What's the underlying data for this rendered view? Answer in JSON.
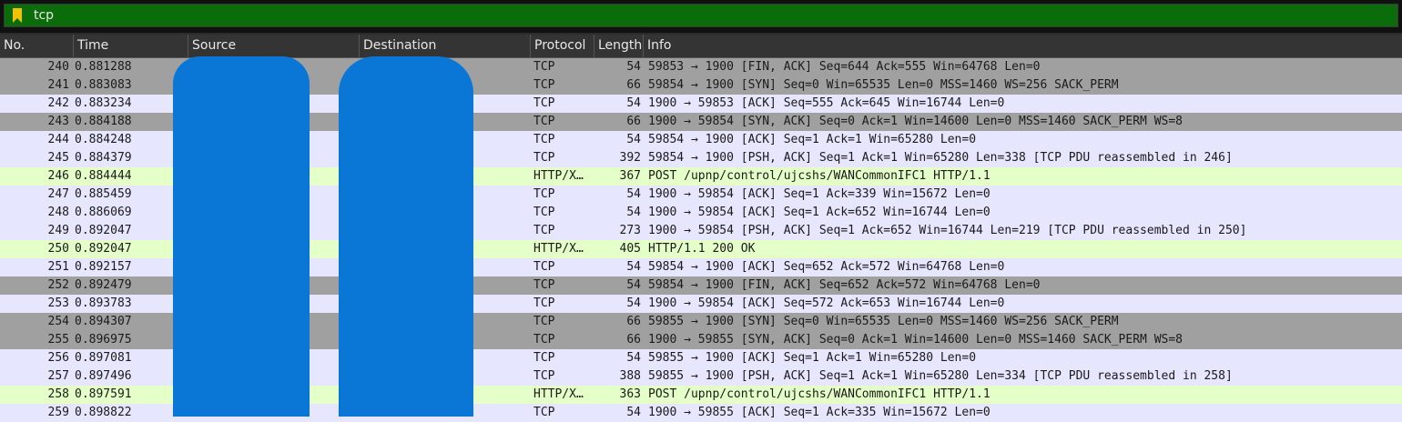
{
  "filter": {
    "value": "tcp",
    "icon": "bookmark-icon"
  },
  "columns": {
    "no": "No.",
    "time": "Time",
    "source": "Source",
    "destination": "Destination",
    "protocol": "Protocol",
    "length": "Length",
    "info": "Info"
  },
  "colors": {
    "filter_valid": "#0a6d0a",
    "tcp_row": "#e7e6ff",
    "tcp_flag_row": "#a0a0a0",
    "http_row": "#e4ffc7",
    "redaction": "#0a77d6"
  },
  "packets": [
    {
      "no": "240",
      "time": "0.881288",
      "protocol": "TCP",
      "length": "54",
      "info": "59853 → 1900 [FIN, ACK] Seq=644 Ack=555 Win=64768 Len=0",
      "kind": "tcp-flags"
    },
    {
      "no": "241",
      "time": "0.883083",
      "protocol": "TCP",
      "length": "66",
      "info": "59854 → 1900 [SYN] Seq=0 Win=65535 Len=0 MSS=1460 WS=256 SACK_PERM",
      "kind": "tcp-flags"
    },
    {
      "no": "242",
      "time": "0.883234",
      "protocol": "TCP",
      "length": "54",
      "info": "1900 → 59853 [ACK] Seq=555 Ack=645 Win=16744 Len=0",
      "kind": "tcp"
    },
    {
      "no": "243",
      "time": "0.884188",
      "protocol": "TCP",
      "length": "66",
      "info": "1900 → 59854 [SYN, ACK] Seq=0 Ack=1 Win=14600 Len=0 MSS=1460 SACK_PERM WS=8",
      "kind": "tcp-flags"
    },
    {
      "no": "244",
      "time": "0.884248",
      "protocol": "TCP",
      "length": "54",
      "info": "59854 → 1900 [ACK] Seq=1 Ack=1 Win=65280 Len=0",
      "kind": "tcp"
    },
    {
      "no": "245",
      "time": "0.884379",
      "protocol": "TCP",
      "length": "392",
      "info": "59854 → 1900 [PSH, ACK] Seq=1 Ack=1 Win=65280 Len=338 [TCP PDU reassembled in 246]",
      "kind": "tcp"
    },
    {
      "no": "246",
      "time": "0.884444",
      "protocol": "HTTP/X…",
      "length": "367",
      "info": "POST /upnp/control/ujcshs/WANCommonIFC1 HTTP/1.1",
      "kind": "http"
    },
    {
      "no": "247",
      "time": "0.885459",
      "protocol": "TCP",
      "length": "54",
      "info": "1900 → 59854 [ACK] Seq=1 Ack=339 Win=15672 Len=0",
      "kind": "tcp"
    },
    {
      "no": "248",
      "time": "0.886069",
      "protocol": "TCP",
      "length": "54",
      "info": "1900 → 59854 [ACK] Seq=1 Ack=652 Win=16744 Len=0",
      "kind": "tcp"
    },
    {
      "no": "249",
      "time": "0.892047",
      "protocol": "TCP",
      "length": "273",
      "info": "1900 → 59854 [PSH, ACK] Seq=1 Ack=652 Win=16744 Len=219 [TCP PDU reassembled in 250]",
      "kind": "tcp"
    },
    {
      "no": "250",
      "time": "0.892047",
      "protocol": "HTTP/X…",
      "length": "405",
      "info": "HTTP/1.1 200 OK",
      "kind": "http"
    },
    {
      "no": "251",
      "time": "0.892157",
      "protocol": "TCP",
      "length": "54",
      "info": "59854 → 1900 [ACK] Seq=652 Ack=572 Win=64768 Len=0",
      "kind": "tcp"
    },
    {
      "no": "252",
      "time": "0.892479",
      "protocol": "TCP",
      "length": "54",
      "info": "59854 → 1900 [FIN, ACK] Seq=652 Ack=572 Win=64768 Len=0",
      "kind": "tcp-flags"
    },
    {
      "no": "253",
      "time": "0.893783",
      "protocol": "TCP",
      "length": "54",
      "info": "1900 → 59854 [ACK] Seq=572 Ack=653 Win=16744 Len=0",
      "kind": "tcp"
    },
    {
      "no": "254",
      "time": "0.894307",
      "protocol": "TCP",
      "length": "66",
      "info": "59855 → 1900 [SYN] Seq=0 Win=65535 Len=0 MSS=1460 WS=256 SACK_PERM",
      "kind": "tcp-flags"
    },
    {
      "no": "255",
      "time": "0.896975",
      "protocol": "TCP",
      "length": "66",
      "info": "1900 → 59855 [SYN, ACK] Seq=0 Ack=1 Win=14600 Len=0 MSS=1460 SACK_PERM WS=8",
      "kind": "tcp-flags"
    },
    {
      "no": "256",
      "time": "0.897081",
      "protocol": "TCP",
      "length": "54",
      "info": "59855 → 1900 [ACK] Seq=1 Ack=1 Win=65280 Len=0",
      "kind": "tcp"
    },
    {
      "no": "257",
      "time": "0.897496",
      "protocol": "TCP",
      "length": "388",
      "info": "59855 → 1900 [PSH, ACK] Seq=1 Ack=1 Win=65280 Len=334 [TCP PDU reassembled in 258]",
      "kind": "tcp"
    },
    {
      "no": "258",
      "time": "0.897591",
      "protocol": "HTTP/X…",
      "length": "363",
      "info": "POST /upnp/control/ujcshs/WANCommonIFC1 HTTP/1.1",
      "kind": "http"
    },
    {
      "no": "259",
      "time": "0.898822",
      "protocol": "TCP",
      "length": "54",
      "info": "1900 → 59855 [ACK] Seq=1 Ack=335 Win=15672 Len=0",
      "kind": "tcp"
    }
  ]
}
